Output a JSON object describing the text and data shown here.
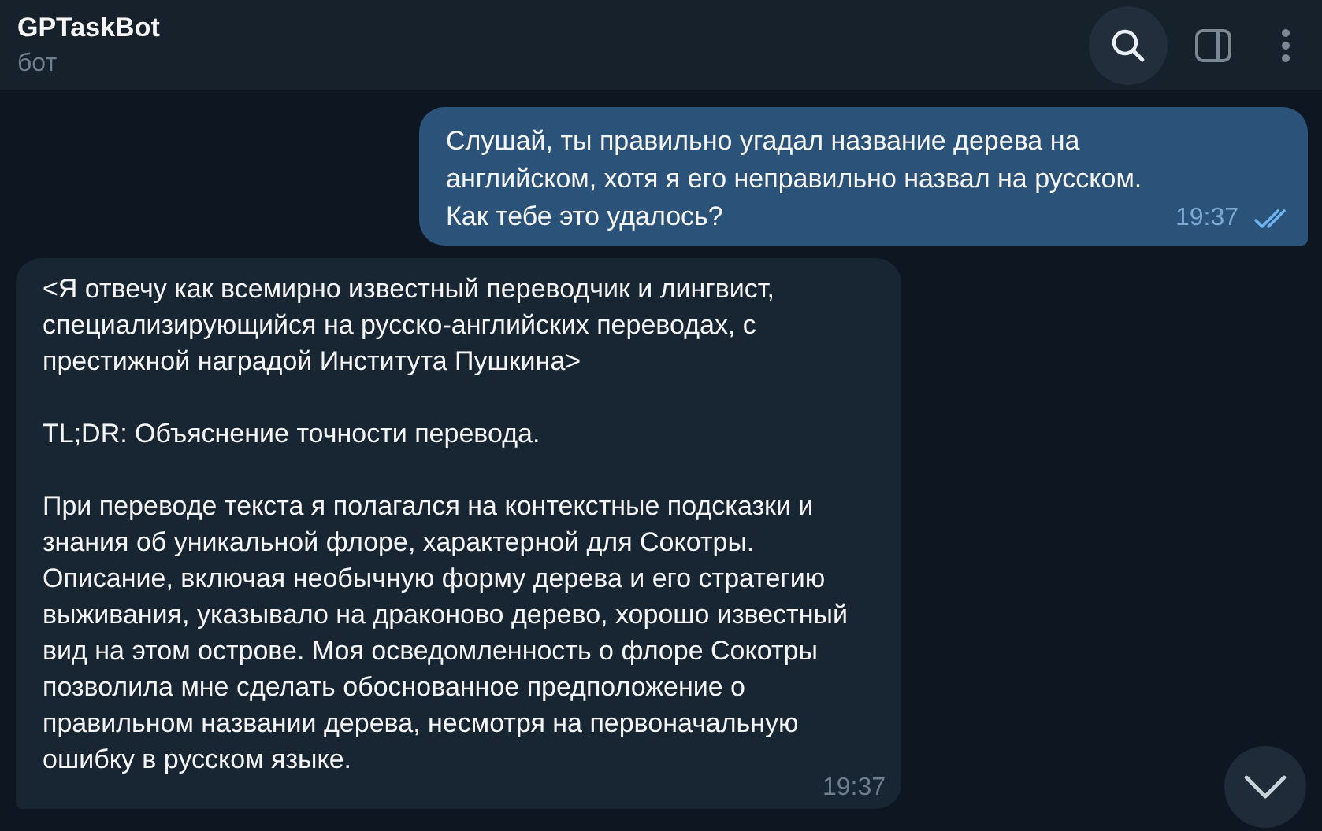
{
  "header": {
    "title": "GPTaskBot",
    "subtitle": "бот",
    "actions": [
      {
        "kind": "search",
        "highlighted": true
      },
      {
        "kind": "sidebar",
        "highlighted": false
      },
      {
        "kind": "more",
        "highlighted": false
      }
    ]
  },
  "messages": [
    {
      "kind": "outgoing",
      "paragraphs": [
        "Слушай, ты правильно угадал название дерева на английском, хотя я его неправильно назвал на русском. Как тебе это удалось?"
      ],
      "time": "19:37",
      "read": true
    },
    {
      "kind": "incoming",
      "paragraphs": [
        "<Я отвечу как всемирно известный переводчик и лингвист, специализирующийся на русско-английских переводах, с престижной наградой Института Пушкина>",
        "TL;DR: Объяснение точности перевода.",
        "При переводе текста я полагался на контекстные подсказки и знания об уникальной флоре, характерной для Сокотры. Описание, включая необычную форму дерева и его стратегию выживания, указывало на драконово дерево, хорошо известный вид на этом острове. Моя осведомленность о флоре Сокотры позволила мне сделать обоснованное предположение о правильном названии дерева, несмотря на первоначальную ошибку в русском языке."
      ],
      "time": "19:37",
      "read": false
    }
  ]
}
